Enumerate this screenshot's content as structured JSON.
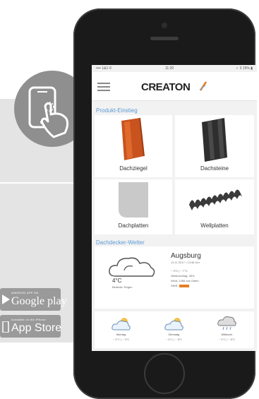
{
  "promo": {
    "google_play": {
      "small": "ANDROID APP ON",
      "big": "Google play"
    },
    "app_store": {
      "small": "Available on the iPhone",
      "big": "App Store"
    }
  },
  "phone": {
    "statusbar": {
      "left": "•••• 1&1 ©",
      "time": "11:20",
      "right": "✓ 3 15% ▮"
    },
    "navbar": {
      "logo": "CREATON"
    },
    "sections": {
      "products": "Produkt-Einstieg",
      "weather": "Dachdecker-Wetter"
    },
    "tiles": [
      {
        "label": "Dachziegel"
      },
      {
        "label": "Dachsteine"
      },
      {
        "label": "Dachplatten"
      },
      {
        "label": "Wellplatten"
      }
    ],
    "weather": {
      "temp": "4°C",
      "condition": "Bedeckt: Regen",
      "city": "Augsburg",
      "date": "13.11.2017 • 13:48 Uhr",
      "details": [
        "~ 2°C | ~ 7°C",
        "Niederschlag: 35%",
        "Wind: 3.8M aus Osten",
        "SWR:"
      ]
    },
    "forecast": [
      {
        "day": "Montag",
        "temp": "~ 4°C | ~ 9°C"
      },
      {
        "day": "Dienstag",
        "temp": "~ 4°C | ~ 8°C"
      },
      {
        "day": "Mittwoch",
        "temp": "~ 4°C | ~ 8°C"
      }
    ]
  }
}
